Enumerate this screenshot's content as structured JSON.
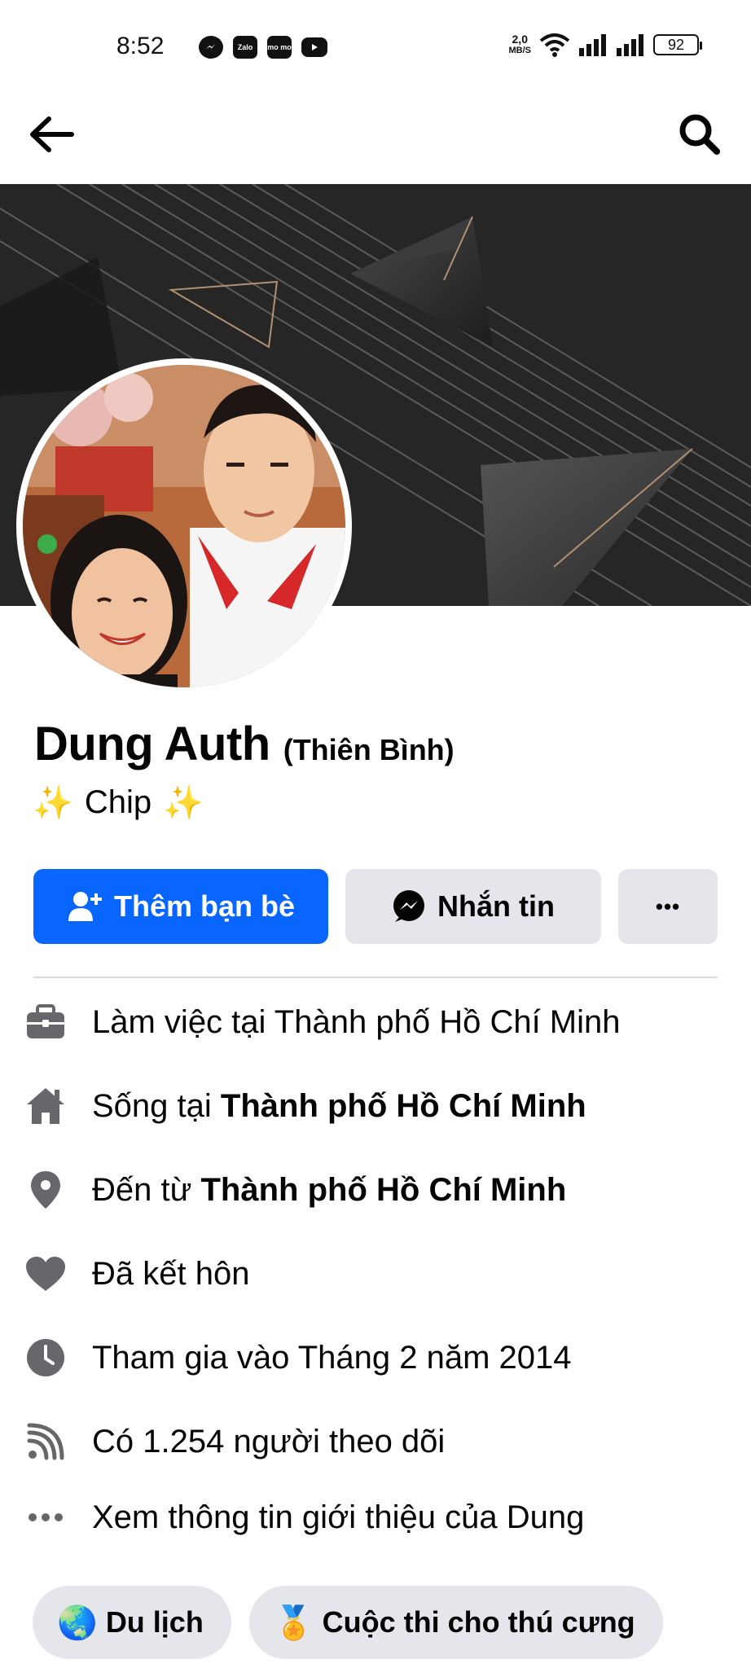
{
  "status_bar": {
    "time": "8:52",
    "apps": [
      "messenger-icon",
      "Zalo",
      "mo mo",
      "youtube-icon"
    ],
    "net_speed_top": "2,0",
    "net_speed_bottom": "MB/S",
    "battery": "92"
  },
  "profile": {
    "name": "Dung Auth",
    "alt_name": "(Thiên Bình)",
    "tagline": "Chip",
    "tagline_emoji": "✨"
  },
  "actions": {
    "add_friend": "Thêm bạn bè",
    "message": "Nhắn tin",
    "more": "•••"
  },
  "details": [
    {
      "icon": "briefcase-icon",
      "prefix": "Làm việc tại Thành phố Hồ Chí Minh",
      "bold": ""
    },
    {
      "icon": "home-icon",
      "prefix": "Sống tại ",
      "bold": "Thành phố Hồ Chí Minh"
    },
    {
      "icon": "location-pin-icon",
      "prefix": "Đến từ ",
      "bold": "Thành phố Hồ Chí Minh"
    },
    {
      "icon": "heart-icon",
      "prefix": "Đã kết hôn",
      "bold": ""
    },
    {
      "icon": "clock-icon",
      "prefix": "Tham gia vào Tháng 2 năm 2014",
      "bold": ""
    },
    {
      "icon": "rss-followers-icon",
      "prefix": "Có 1.254 người theo dõi",
      "bold": ""
    },
    {
      "icon": "more-dots-icon",
      "prefix": "Xem thông tin giới thiệu của Dung",
      "bold": ""
    }
  ],
  "chips": [
    {
      "emoji": "🌏",
      "label": "Du lịch"
    },
    {
      "emoji": "🏅",
      "label": "Cuộc thi cho thú cưng"
    }
  ],
  "colors": {
    "primary": "#0866ff",
    "secondary_button": "#e4e6eb",
    "icon_gray": "#65676b",
    "text": "#050505"
  }
}
